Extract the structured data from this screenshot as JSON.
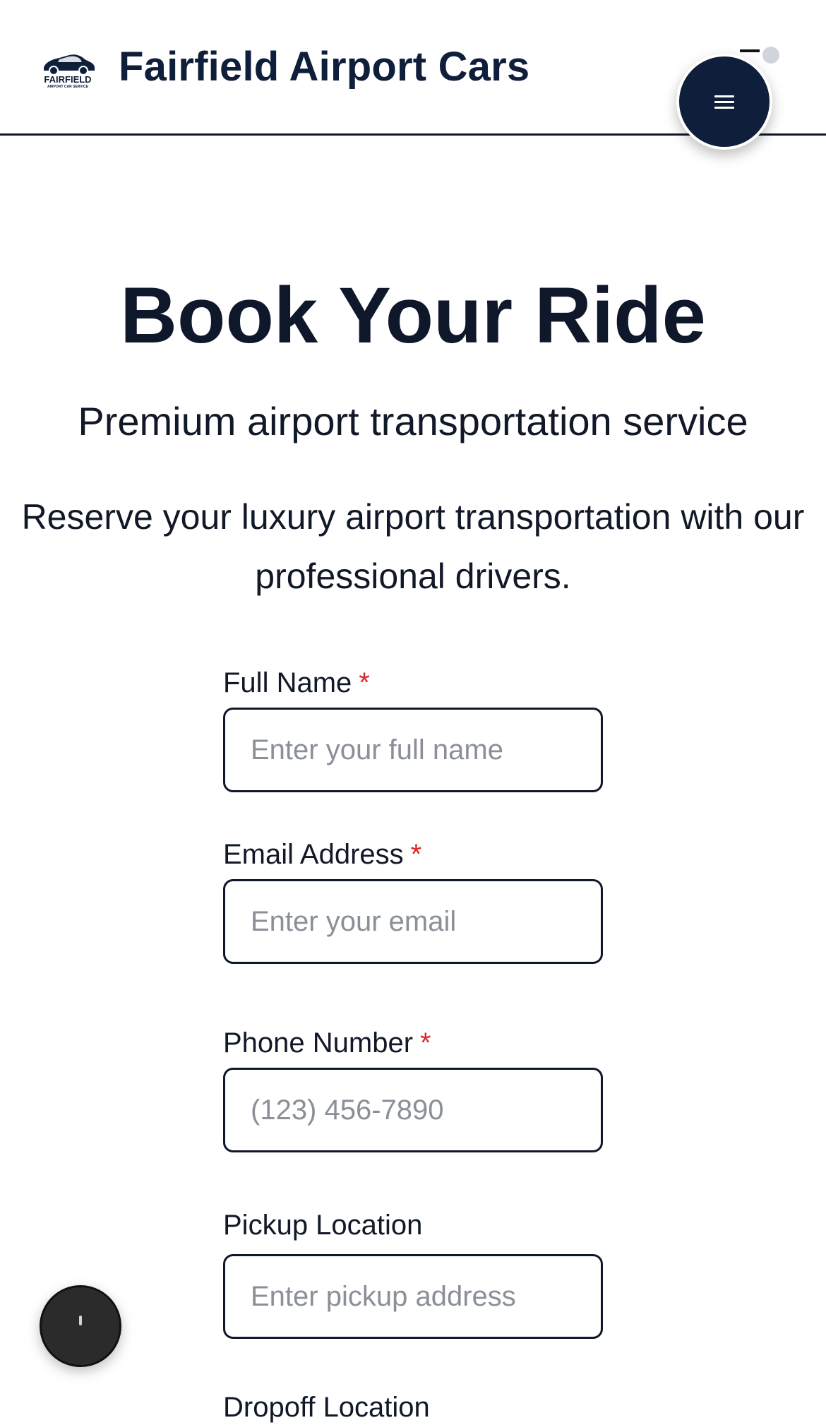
{
  "header": {
    "logo_text": "FAIRFIELD",
    "logo_subtext": "AIRPORT CAR SERVICE",
    "brand": "Fairfield Airport Cars"
  },
  "hero": {
    "title": "Book Your Ride",
    "subtitle": "Premium airport transportation service",
    "description": "Reserve your luxury airport transportation with our professional drivers."
  },
  "form": {
    "full_name": {
      "label": "Full Name",
      "required_mark": "*",
      "placeholder": "Enter your full name",
      "value": ""
    },
    "email": {
      "label": "Email Address",
      "required_mark": "*",
      "placeholder": "Enter your email",
      "value": ""
    },
    "phone": {
      "label": "Phone Number",
      "required_mark": "*",
      "placeholder": "(123) 456-7890",
      "value": ""
    },
    "pickup": {
      "label": "Pickup Location",
      "placeholder": "Enter pickup address",
      "value": ""
    },
    "dropoff": {
      "label": "Dropoff Location"
    }
  },
  "icons": {
    "menu": "menu-icon",
    "logo": "car-icon"
  },
  "colors": {
    "navy": "#0f1e3a",
    "required": "#dc2626",
    "border": "#0f172a"
  }
}
